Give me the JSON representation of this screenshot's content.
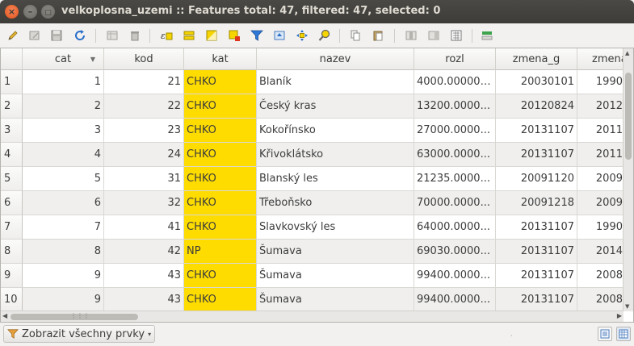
{
  "window": {
    "title": "velkoplosna_uzemi :: Features total: 47, filtered: 47, selected: 0",
    "close_glyph": "×",
    "min_glyph": "–",
    "max_glyph": "▢"
  },
  "toolbar": {
    "icons": [
      "pencil-icon",
      "edit-table-icon",
      "save-icon",
      "reload-icon",
      "add-feature-icon",
      "delete-icon",
      "expression-select-icon",
      "select-all-icon",
      "invert-selection-icon",
      "deselect-icon",
      "filter-icon",
      "move-selection-top-icon",
      "pan-to-selection-icon",
      "zoom-to-selection-icon",
      "copy-icon",
      "paste-icon",
      "delete-field-icon",
      "new-field-icon",
      "field-calculator-icon",
      "conditional-format-icon"
    ]
  },
  "colors": {
    "category_highlight": "#ffdc00",
    "title_bar": "#3d3c38",
    "close_button": "#e2531d"
  },
  "table": {
    "columns": [
      "cat",
      "kod",
      "kat",
      "nazev",
      "rozl",
      "zmena_g",
      "zmena"
    ],
    "sort_indicator": "▼",
    "rows": [
      {
        "n": "1",
        "cat": "1",
        "kod": "21",
        "kat": "CHKO",
        "nazev": "Blaník",
        "rozl": "4000.000000...",
        "zmena_g": "20030101",
        "zmena": "1990"
      },
      {
        "n": "2",
        "cat": "2",
        "kod": "22",
        "kat": "CHKO",
        "nazev": "Český kras",
        "rozl": "13200.0000...",
        "zmena_g": "20120824",
        "zmena": "2012"
      },
      {
        "n": "3",
        "cat": "3",
        "kod": "23",
        "kat": "CHKO",
        "nazev": "Kokořínsko",
        "rozl": "27000.0000...",
        "zmena_g": "20131107",
        "zmena": "2011"
      },
      {
        "n": "4",
        "cat": "4",
        "kod": "24",
        "kat": "CHKO",
        "nazev": "Křivoklátsko",
        "rozl": "63000.0000...",
        "zmena_g": "20131107",
        "zmena": "2011"
      },
      {
        "n": "5",
        "cat": "5",
        "kod": "31",
        "kat": "CHKO",
        "nazev": "Blanský les",
        "rozl": "21235.0000...",
        "zmena_g": "20091120",
        "zmena": "2009"
      },
      {
        "n": "6",
        "cat": "6",
        "kod": "32",
        "kat": "CHKO",
        "nazev": "Třeboňsko",
        "rozl": "70000.0000...",
        "zmena_g": "20091218",
        "zmena": "2009"
      },
      {
        "n": "7",
        "cat": "7",
        "kod": "41",
        "kat": "CHKO",
        "nazev": "Slavkovský les",
        "rozl": "64000.0000...",
        "zmena_g": "20131107",
        "zmena": "1990"
      },
      {
        "n": "8",
        "cat": "8",
        "kod": "42",
        "kat": "NP",
        "nazev": "Šumava",
        "rozl": "69030.0000...",
        "zmena_g": "20131107",
        "zmena": "2014"
      },
      {
        "n": "9",
        "cat": "9",
        "kod": "43",
        "kat": "CHKO",
        "nazev": "Šumava",
        "rozl": "99400.0000...",
        "zmena_g": "20131107",
        "zmena": "2008"
      },
      {
        "n": "10",
        "cat": "9",
        "kod": "43",
        "kat": "CHKO",
        "nazev": "Šumava",
        "rozl": "99400.0000...",
        "zmena_g": "20131107",
        "zmena": "2008"
      }
    ]
  },
  "scroll": {
    "grip": "⋮⋮⋮",
    "up": "▲",
    "down": "▼",
    "left": "◀",
    "right": "▶"
  },
  "bottom": {
    "filter_label": "Zobrazit všechny prvky",
    "filter_caret": "▾",
    "dot": "·"
  }
}
